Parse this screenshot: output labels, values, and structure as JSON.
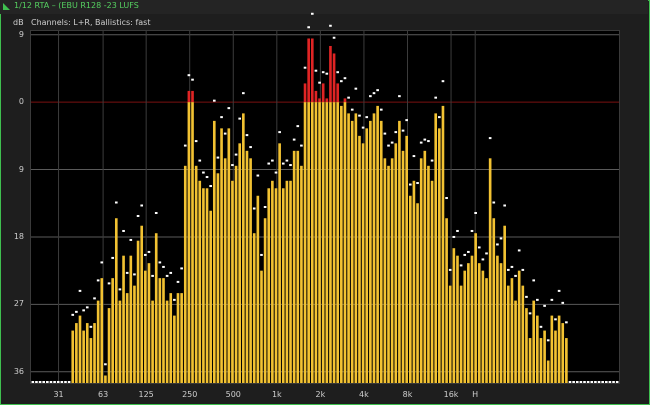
{
  "window": {
    "title": "1/12 RTA – (EBU R128 -23 LUFS"
  },
  "header": {
    "unit": "dB",
    "channels": "Channels: L+R, Ballistics: fast"
  },
  "colors": {
    "bar": "#f2c232",
    "clip": "#e02424",
    "peak": "#ffffff",
    "accent": "#3fbf4f",
    "plot_bg": "#000000"
  },
  "chart_data": {
    "type": "bar",
    "title": "",
    "xlabel": "",
    "ylabel": "dB",
    "ylim": [
      37.5,
      -9.5
    ],
    "clip_level": 0,
    "y_ticks": [
      "9",
      "0",
      "9",
      "18",
      "27",
      "36"
    ],
    "y_tick_values": [
      -9,
      0,
      9,
      18,
      27,
      36
    ],
    "x_ticks": [
      "31",
      "63",
      "125",
      "250",
      "500",
      "1k",
      "2k",
      "4k",
      "8k",
      "16k",
      "H"
    ],
    "x_tick_freqs": [
      31,
      63,
      125,
      250,
      500,
      1000,
      2000,
      4000,
      8000,
      16000,
      23500
    ],
    "freq_start": 20,
    "bands_per_octave": 12,
    "values": [
      37.5,
      37.5,
      37.5,
      37.5,
      37.5,
      37.5,
      37.5,
      37.5,
      37.5,
      37.5,
      37.5,
      30.5,
      29.5,
      28.5,
      30.5,
      29.5,
      31.5,
      29.5,
      26.5,
      23.5,
      36.5,
      27.5,
      23.5,
      15.5,
      26.5,
      20.5,
      25.5,
      20.5,
      24.5,
      18.5,
      16.5,
      22.5,
      21.5,
      26.5,
      17.5,
      23.5,
      23.5,
      26.5,
      25.5,
      28.5,
      25.5,
      25.5,
      8.5,
      -1.5,
      -1.5,
      8.5,
      10.5,
      11.5,
      11.5,
      14.5,
      2.5,
      9.5,
      3.5,
      7.5,
      3.5,
      10.5,
      8.5,
      5.5,
      1.5,
      6.5,
      7.5,
      17.5,
      12.5,
      22.5,
      15.5,
      11.5,
      10.5,
      11.5,
      5.5,
      11.5,
      10.5,
      10.5,
      6.5,
      6.5,
      8.5,
      -2.5,
      -8.5,
      -8.5,
      -1.5,
      -0.5,
      -2.5,
      -0.5,
      -7.5,
      -6.5,
      -2.5,
      0.5,
      -0.5,
      1.5,
      2.5,
      1.5,
      4.5,
      5.5,
      3.5,
      2.5,
      1.5,
      0.5,
      2.5,
      7.5,
      8.5,
      7.5,
      5.5,
      2.5,
      6.5,
      4.5,
      12.5,
      10.5,
      13.5,
      7.5,
      6.5,
      8.5,
      10.5,
      1.5,
      3.5,
      0.5,
      15.5,
      24.5,
      19.5,
      20.5,
      24.5,
      22.5,
      21.5,
      20.5,
      17.5,
      21.5,
      22.5,
      23.5,
      7.5,
      15.5,
      20.5,
      21.5,
      16.5,
      24.5,
      23.5,
      26.5,
      22.5,
      24.5,
      27.5,
      31.5,
      26.5,
      28.5,
      31.5,
      30.5,
      34.5,
      28.5,
      30.5,
      28.5,
      29.5,
      31.5,
      37.5,
      37.5,
      37.5,
      37.5,
      37.5,
      37.5,
      37.5,
      37.5,
      37.5,
      37.5,
      37.5,
      37.5,
      37.5,
      37.5
    ]
  }
}
